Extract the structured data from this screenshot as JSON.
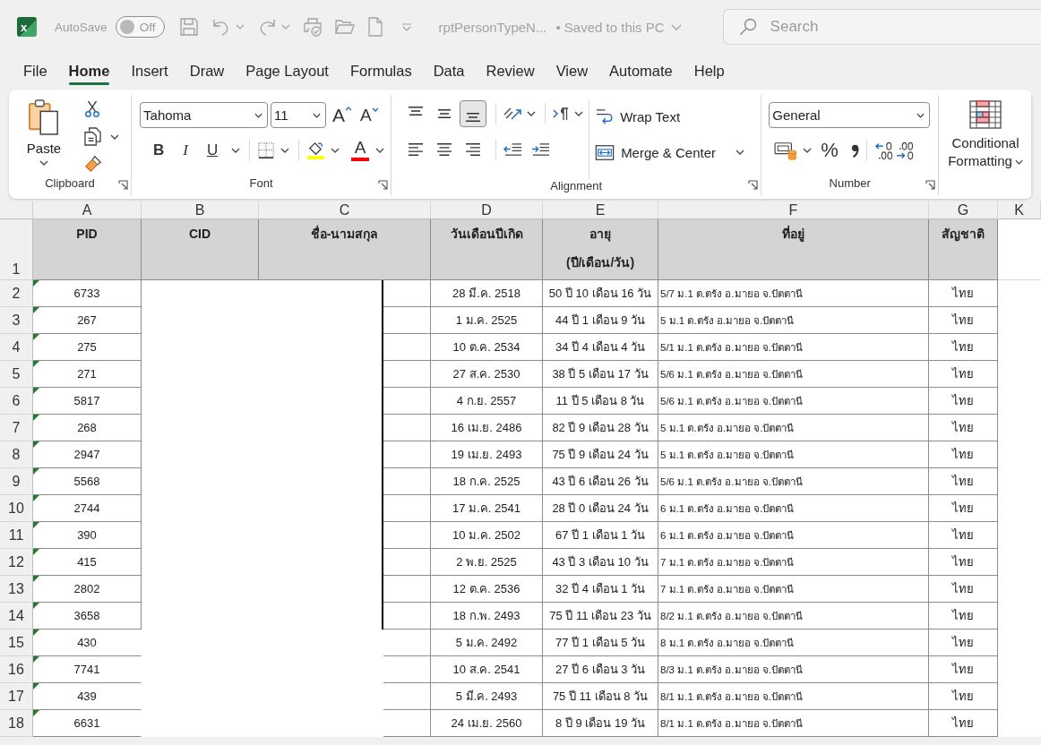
{
  "title_bar": {
    "logo_letter": "x",
    "autosave": {
      "label": "AutoSave",
      "on": false,
      "state_label": "Off"
    },
    "document_title": "rptPersonTypeN...",
    "save_status": "• Saved to this PC",
    "search": {
      "placeholder": "Search"
    }
  },
  "tabs": [
    {
      "label": "File",
      "selected": false
    },
    {
      "label": "Home",
      "selected": true
    },
    {
      "label": "Insert",
      "selected": false
    },
    {
      "label": "Draw",
      "selected": false
    },
    {
      "label": "Page Layout",
      "selected": false
    },
    {
      "label": "Formulas",
      "selected": false
    },
    {
      "label": "Data",
      "selected": false
    },
    {
      "label": "Review",
      "selected": false
    },
    {
      "label": "View",
      "selected": false
    },
    {
      "label": "Automate",
      "selected": false
    },
    {
      "label": "Help",
      "selected": false
    }
  ],
  "ribbon": {
    "clipboard": {
      "paste": "Paste",
      "label": "Clipboard"
    },
    "font": {
      "name": "Tahoma",
      "size": "11",
      "grow_glyph": "A",
      "shrink_glyph": "A",
      "styles": [
        {
          "kind": "bold",
          "glyph": "B"
        },
        {
          "kind": "italic",
          "glyph": "I"
        },
        {
          "kind": "underline",
          "glyph": "U"
        }
      ],
      "font_color_glyph": "A",
      "label": "Font"
    },
    "alignment": {
      "vertical": [
        {
          "kind": "top",
          "selected": false
        },
        {
          "kind": "middle",
          "selected": false
        },
        {
          "kind": "bottom",
          "selected": true
        }
      ],
      "horizontal": [
        {
          "kind": "left",
          "selected": false
        },
        {
          "kind": "center",
          "selected": false
        },
        {
          "kind": "right",
          "selected": false
        }
      ],
      "wrap_text": "Wrap Text",
      "merge": "Merge & Center",
      "label": "Alignment"
    },
    "number": {
      "format": "General",
      "percent_glyph": "%",
      "label": "Number"
    },
    "styles": {
      "conditional_formatting": "Conditional Formatting"
    }
  },
  "sheet": {
    "columns": [
      "A",
      "B",
      "C",
      "D",
      "E",
      "F",
      "G",
      "K"
    ],
    "header": {
      "row_number": "1",
      "cells": [
        "PID",
        "CID",
        "ชื่อ-นามสกุล",
        "วันเดือนปีเกิด",
        "อายุ\n(ปี/เดือน/วัน)",
        "ที่อยู่",
        "สัญชาติ"
      ]
    },
    "rows": [
      {
        "row_number": "2",
        "pid": "6733",
        "flagged_as_text": true,
        "birth_date": "28 มี.ค. 2518",
        "age": "50 ปี 10 เดือน 16 วัน",
        "address": "5/7 ม.1 ต.ตรัง อ.มายอ จ.ปัตตานี",
        "nationality": "ไทย"
      },
      {
        "row_number": "3",
        "pid": "267",
        "flagged_as_text": true,
        "birth_date": "1 ม.ค. 2525",
        "age": "44 ปี 1 เดือน 9 วัน",
        "address": "5 ม.1 ต.ตรัง อ.มายอ จ.ปัตตานี",
        "nationality": "ไทย"
      },
      {
        "row_number": "4",
        "pid": "275",
        "flagged_as_text": true,
        "birth_date": "10 ต.ค. 2534",
        "age": "34 ปี 4 เดือน 4 วัน",
        "address": "5/1 ม.1 ต.ตรัง อ.มายอ จ.ปัตตานี",
        "nationality": "ไทย"
      },
      {
        "row_number": "5",
        "pid": "271",
        "flagged_as_text": true,
        "birth_date": "27 ส.ค. 2530",
        "age": "38 ปี 5 เดือน 17 วัน",
        "address": "5/6 ม.1 ต.ตรัง อ.มายอ จ.ปัตตานี",
        "nationality": "ไทย"
      },
      {
        "row_number": "6",
        "pid": "5817",
        "flagged_as_text": true,
        "birth_date": "4 ก.ย. 2557",
        "age": "11 ปี 5 เดือน 8 วัน",
        "address": "5/6 ม.1 ต.ตรัง อ.มายอ จ.ปัตตานี",
        "nationality": "ไทย"
      },
      {
        "row_number": "7",
        "pid": "268",
        "flagged_as_text": true,
        "birth_date": "16 เม.ย. 2486",
        "age": "82 ปี 9 เดือน 28 วัน",
        "address": "5 ม.1 ต.ตรัง อ.มายอ จ.ปัตตานี",
        "nationality": "ไทย"
      },
      {
        "row_number": "8",
        "pid": "2947",
        "flagged_as_text": true,
        "birth_date": "19 เม.ย. 2493",
        "age": "75 ปี 9 เดือน 24 วัน",
        "address": "5 ม.1 ต.ตรัง อ.มายอ จ.ปัตตานี",
        "nationality": "ไทย"
      },
      {
        "row_number": "9",
        "pid": "5568",
        "flagged_as_text": true,
        "birth_date": "18 ก.ค. 2525",
        "age": "43 ปี 6 เดือน 26 วัน",
        "address": "5/6 ม.1 ต.ตรัง อ.มายอ จ.ปัตตานี",
        "nationality": "ไทย"
      },
      {
        "row_number": "10",
        "pid": "2744",
        "flagged_as_text": true,
        "birth_date": "17 ม.ค. 2541",
        "age": "28 ปี 0 เดือน 24 วัน",
        "address": "6 ม.1 ต.ตรัง อ.มายอ จ.ปัตตานี",
        "nationality": "ไทย"
      },
      {
        "row_number": "11",
        "pid": "390",
        "flagged_as_text": true,
        "birth_date": "10 ม.ค. 2502",
        "age": "67 ปี 1 เดือน 1 วัน",
        "address": "6 ม.1 ต.ตรัง อ.มายอ จ.ปัตตานี",
        "nationality": "ไทย"
      },
      {
        "row_number": "12",
        "pid": "415",
        "flagged_as_text": true,
        "birth_date": "2 พ.ย. 2525",
        "age": "43 ปี 3 เดือน 10 วัน",
        "address": "7 ม.1 ต.ตรัง อ.มายอ จ.ปัตตานี",
        "nationality": "ไทย"
      },
      {
        "row_number": "13",
        "pid": "2802",
        "flagged_as_text": true,
        "birth_date": "12 ต.ค. 2536",
        "age": "32 ปี 4 เดือน 1 วัน",
        "address": "7 ม.1 ต.ตรัง อ.มายอ จ.ปัตตานี",
        "nationality": "ไทย"
      },
      {
        "row_number": "14",
        "pid": "3658",
        "flagged_as_text": true,
        "birth_date": "18 ก.พ. 2493",
        "age": "75 ปี 11 เดือน 23 วัน",
        "address": "8/2 ม.1 ต.ตรัง อ.มายอ จ.ปัตตานี",
        "nationality": "ไทย"
      },
      {
        "row_number": "15",
        "pid": "430",
        "flagged_as_text": true,
        "birth_date": "5 ม.ค. 2492",
        "age": "77 ปี 1 เดือน 5 วัน",
        "address": "8 ม.1 ต.ตรัง อ.มายอ จ.ปัตตานี",
        "nationality": "ไทย"
      },
      {
        "row_number": "16",
        "pid": "7741",
        "flagged_as_text": true,
        "birth_date": "10 ส.ค. 2541",
        "age": "27 ปี 6 เดือน 3 วัน",
        "address": "8/3 ม.1 ต.ตรัง อ.มายอ จ.ปัตตานี",
        "nationality": "ไทย"
      },
      {
        "row_number": "17",
        "pid": "439",
        "flagged_as_text": true,
        "birth_date": "5 มี.ค. 2493",
        "age": "75 ปี 11 เดือน 8 วัน",
        "address": "8/1 ม.1 ต.ตรัง อ.มายอ จ.ปัตตานี",
        "nationality": "ไทย"
      },
      {
        "row_number": "18",
        "pid": "6631",
        "flagged_as_text": true,
        "birth_date": "24 เม.ย. 2560",
        "age": "8 ปี 9 เดือน 19 วัน",
        "address": "8/1 ม.1 ต.ตรัง อ.มายอ จ.ปัตตานี",
        "nationality": "ไทย"
      }
    ]
  }
}
